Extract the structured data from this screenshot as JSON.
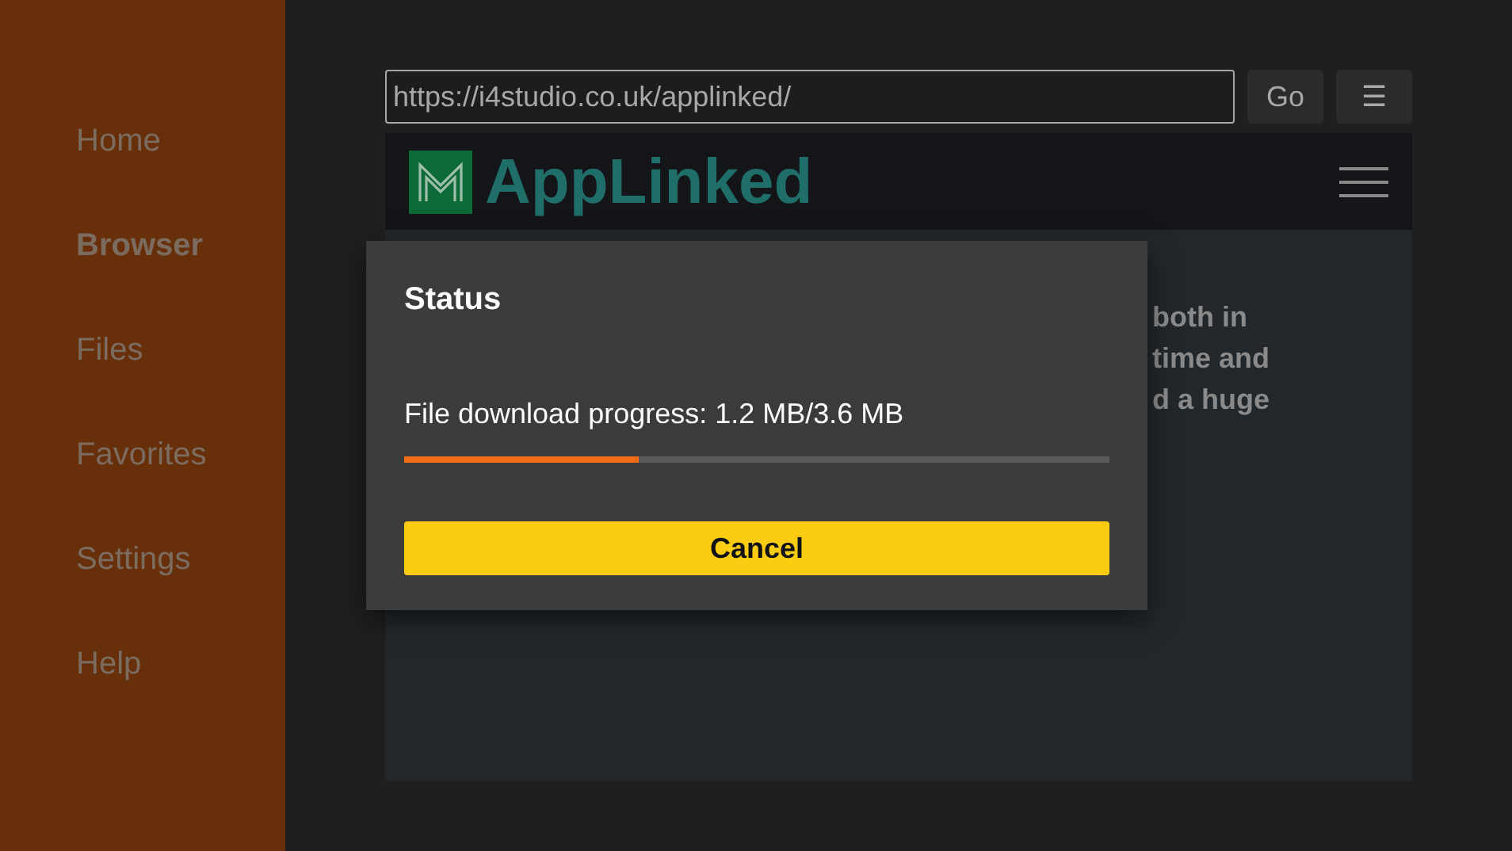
{
  "sidebar": {
    "items": [
      {
        "label": "Home",
        "selected": false
      },
      {
        "label": "Browser",
        "selected": true
      },
      {
        "label": "Files",
        "selected": false
      },
      {
        "label": "Favorites",
        "selected": false
      },
      {
        "label": "Settings",
        "selected": false
      },
      {
        "label": "Help",
        "selected": false
      }
    ]
  },
  "browser": {
    "url": "https://i4studio.co.uk/applinked/",
    "go_button": "Go",
    "menu_button": "☰"
  },
  "web_page": {
    "logo_text": "AppLinked",
    "paragraph_lines": [
      "both in",
      "time and",
      "d a huge"
    ]
  },
  "dialog": {
    "title": "Status",
    "message": "File download progress: 1.2 MB/3.6 MB",
    "progress": {
      "level": 0.333
    },
    "button": "Cancel"
  }
}
